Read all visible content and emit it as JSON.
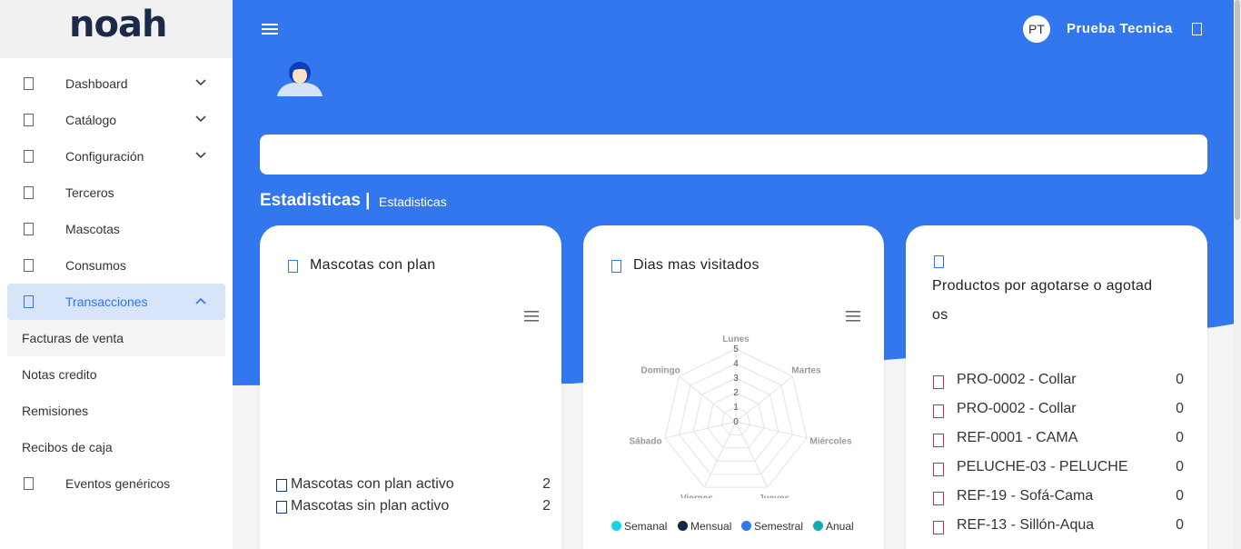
{
  "app": {
    "logo": "noah"
  },
  "sidebar": {
    "items": [
      {
        "label": "Dashboard",
        "has_chevron": true
      },
      {
        "label": "Catálogo",
        "has_chevron": true
      },
      {
        "label": "Configuración",
        "has_chevron": true
      },
      {
        "label": "Terceros"
      },
      {
        "label": "Mascotas"
      },
      {
        "label": "Consumos"
      },
      {
        "label": "Transacciones",
        "active": true,
        "expanded": true
      }
    ],
    "subitems": [
      {
        "label": "Facturas de venta",
        "active": true
      },
      {
        "label": "Notas credito"
      },
      {
        "label": "Remisiones"
      },
      {
        "label": "Recibos de caja"
      }
    ],
    "extra_item": {
      "label": "Eventos genéricos"
    }
  },
  "header": {
    "user_initials": "PT",
    "user_name": "Prueba Tecnica"
  },
  "page": {
    "title": "Estadisticas |",
    "breadcrumb": "Estadisticas"
  },
  "colors": {
    "accent": "#3377ee",
    "sidebar_active": "#d7e4fa"
  },
  "cards": {
    "plans": {
      "title": "Mascotas con plan",
      "legend": [
        {
          "label": "Mascotas con plan activo",
          "value": "2"
        },
        {
          "label": "Mascotas sin plan activo",
          "value": "2"
        }
      ]
    },
    "days": {
      "title": "Dias mas visitados",
      "chart_data": {
        "type": "radar",
        "categories": [
          "Lunes",
          "Martes",
          "Miércoles",
          "Jueves",
          "Viernes",
          "Sábado",
          "Domingo"
        ],
        "scale_labels": [
          "0",
          "1",
          "2",
          "3",
          "4",
          "5"
        ],
        "series": [
          {
            "name": "Semanal",
            "color": "#17d4e8",
            "values": [
              0,
              0,
              0,
              0,
              0,
              0,
              0
            ]
          },
          {
            "name": "Mensual",
            "color": "#14264a",
            "values": [
              0,
              0,
              0,
              0,
              0,
              0,
              0
            ]
          },
          {
            "name": "Semestral",
            "color": "#3377ee",
            "values": [
              0,
              0,
              0,
              0,
              0,
              0,
              0
            ]
          },
          {
            "name": "Anual",
            "color": "#14a8b4",
            "values": [
              0,
              0,
              0,
              0,
              0,
              0,
              0
            ]
          }
        ]
      }
    },
    "products": {
      "title_line1": "Productos por agotarse o agotad",
      "title_line2": "os",
      "items": [
        {
          "label": "PRO-0002 - Collar",
          "value": "0"
        },
        {
          "label": "PRO-0002 - Collar",
          "value": "0"
        },
        {
          "label": "REF-0001 - CAMA",
          "value": "0"
        },
        {
          "label": "PELUCHE-03 - PELUCHE",
          "value": "0"
        },
        {
          "label": "REF-19 - Sofá-Cama",
          "value": "0"
        },
        {
          "label": "REF-13 - Sillón-Aqua",
          "value": "0"
        }
      ]
    }
  }
}
